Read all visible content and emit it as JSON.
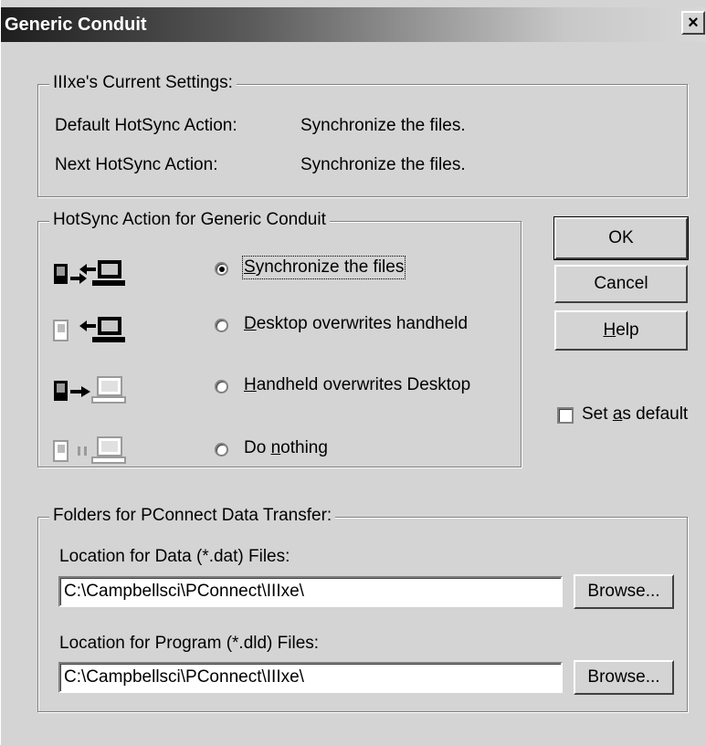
{
  "window": {
    "title": "Generic Conduit",
    "close_glyph": "×"
  },
  "current_settings": {
    "legend": "IIIxe's Current Settings:",
    "rows": [
      {
        "label": "Default HotSync Action:",
        "value": "Synchronize the files."
      },
      {
        "label": "Next HotSync Action:",
        "value": "Synchronize the files."
      }
    ]
  },
  "hotsync_action": {
    "legend": "HotSync Action for Generic Conduit",
    "options": [
      {
        "label": "Synchronize the files",
        "mnemonic": "S",
        "rest": "ynchronize the files",
        "selected": true,
        "icon": "sync-both-icon"
      },
      {
        "label": "Desktop overwrites handheld",
        "mnemonic": "D",
        "rest": "esktop overwrites handheld",
        "selected": false,
        "icon": "desktop-to-handheld-icon"
      },
      {
        "label": "Handheld overwrites Desktop",
        "mnemonic": "H",
        "rest": "andheld overwrites Desktop",
        "selected": false,
        "icon": "handheld-to-desktop-icon"
      },
      {
        "label": "Do nothing",
        "pre": "Do ",
        "mnemonic": "n",
        "rest": "othing",
        "selected": false,
        "icon": "do-nothing-icon"
      }
    ]
  },
  "buttons": {
    "ok": "OK",
    "cancel": "Cancel",
    "help_mnemonic": "H",
    "help_rest": "elp"
  },
  "set_default": {
    "pre": "Set ",
    "mnemonic": "a",
    "rest": "s default",
    "checked": false
  },
  "folders": {
    "legend": "Folders for PConnect Data Transfer:",
    "data_label": "Location for Data (*.dat) Files:",
    "data_value": "C:\\Campbellsci\\PConnect\\IIIxe\\",
    "program_label": "Location for Program (*.dld) Files:",
    "program_value": "C:\\Campbellsci\\PConnect\\IIIxe\\",
    "browse": "Browse..."
  }
}
